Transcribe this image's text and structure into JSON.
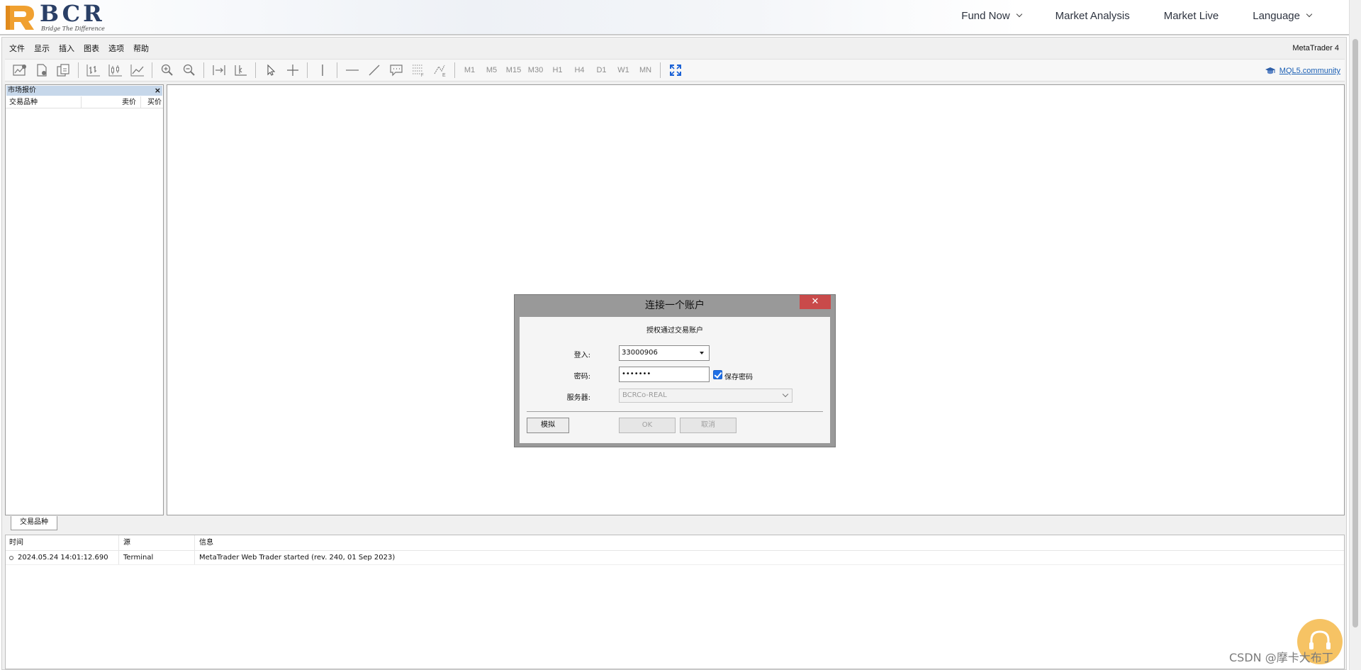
{
  "site": {
    "logo_text": "BCR",
    "logo_tagline": "Bridge The Difference",
    "nav": [
      {
        "label": "Fund Now"
      },
      {
        "label": "Market Analysis"
      },
      {
        "label": "Market Live"
      },
      {
        "label": "Language"
      }
    ]
  },
  "app": {
    "name": "MetaTrader 4",
    "menu": [
      "文件",
      "显示",
      "插入",
      "图表",
      "选项",
      "帮助"
    ],
    "toolbar": {
      "timeframes": [
        "M1",
        "M5",
        "M15",
        "M30",
        "H1",
        "H4",
        "D1",
        "W1",
        "MN"
      ],
      "community_link": "MQL5.community"
    }
  },
  "market_watch": {
    "title": "市场报价",
    "close_glyph": "×",
    "columns": [
      "交易品种",
      "卖价",
      "买价"
    ],
    "tab": "交易品种"
  },
  "terminal": {
    "columns": [
      "时间",
      "源",
      "信息"
    ],
    "rows": [
      {
        "time": "2024.05.24 14:01:12.690",
        "source": "Terminal",
        "message": "MetaTrader Web Trader started (rev. 240, 01 Sep 2023)"
      }
    ]
  },
  "dialog": {
    "title": "连接一个账户",
    "close_glyph": "✕",
    "subtitle": "授权通过交易账户",
    "login_label": "登入:",
    "login_value": "33000906",
    "password_label": "密码:",
    "password_value": "•••••••",
    "save_password_label": "保存密码",
    "save_password_checked": true,
    "server_label": "服务器:",
    "server_value": "BCRCo-REAL",
    "demo_button": "模拟",
    "ok_button": "OK",
    "cancel_button": "取消"
  },
  "watermark": "CSDN @摩卡大布丁",
  "colors": {
    "brand_orange": "#f0a030",
    "brand_navy": "#2a3f66",
    "dialog_close_red": "#c94a4a",
    "checkbox_blue": "#1f6fe6",
    "link_blue": "#1a5fb4"
  }
}
